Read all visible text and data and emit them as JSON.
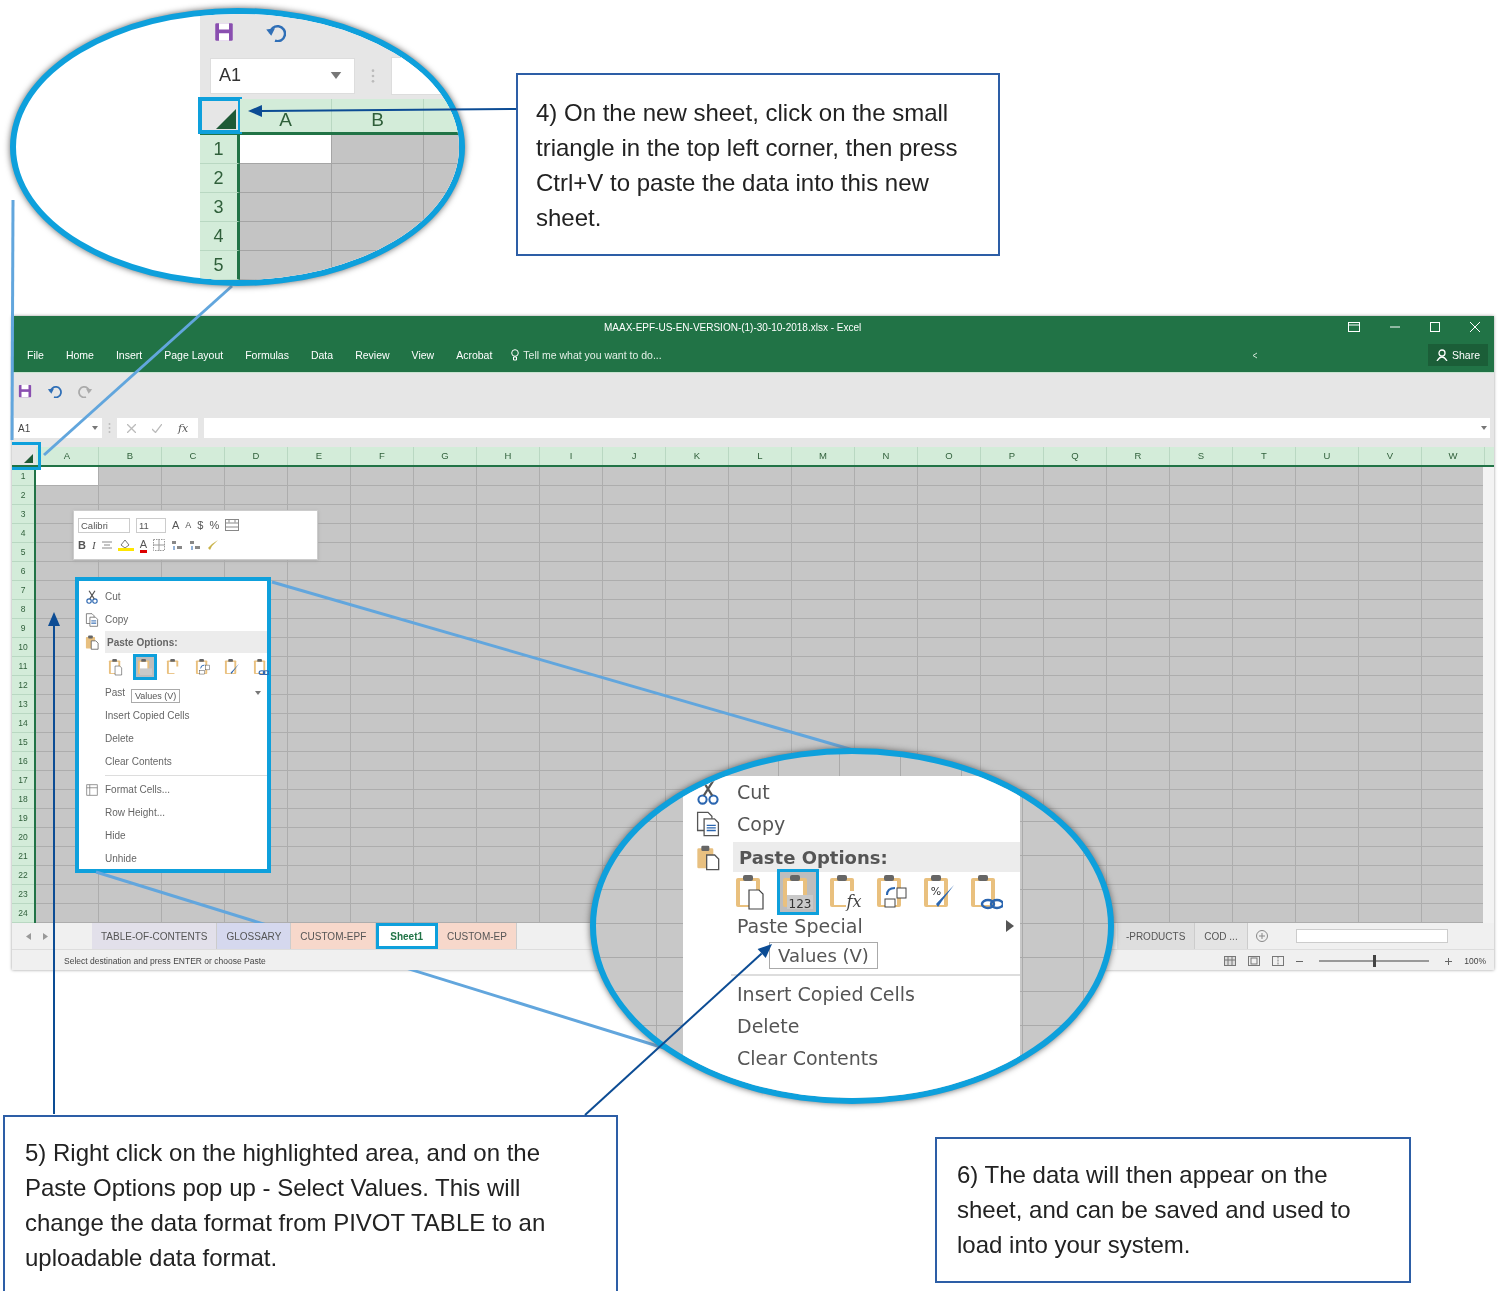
{
  "magnifier_top": {
    "name_box": "A1",
    "columns": [
      "A",
      "B"
    ],
    "rows": [
      "1",
      "2",
      "3",
      "4",
      "5"
    ]
  },
  "excel": {
    "title": "MAAX-EPF-US-EN-VERSION-(1)-30-10-2018.xlsx - Excel",
    "ribbon_tabs": [
      "File",
      "Home",
      "Insert",
      "Page Layout",
      "Formulas",
      "Data",
      "Review",
      "View",
      "Acrobat"
    ],
    "tell_me": "Tell me what you want to do...",
    "share": "Share",
    "name_box": "A1",
    "fx": "fx",
    "columns": [
      "A",
      "B",
      "C",
      "D",
      "E",
      "F",
      "G",
      "H",
      "I",
      "J",
      "K",
      "L",
      "M",
      "N",
      "O",
      "P",
      "Q",
      "R",
      "S",
      "T",
      "U",
      "V",
      "W"
    ],
    "rows": [
      "1",
      "2",
      "3",
      "4",
      "5",
      "6",
      "7",
      "8",
      "9",
      "10",
      "11",
      "12",
      "13",
      "14",
      "15",
      "16",
      "17",
      "18",
      "19",
      "20",
      "21",
      "22",
      "23",
      "24"
    ],
    "sheet_tabs": [
      {
        "label": "TABLE-OF-CONTENTS",
        "selected": false,
        "color": "#e2e0ea"
      },
      {
        "label": "GLOSSARY",
        "selected": false,
        "color": "#d5d8ee"
      },
      {
        "label": "CUSTOM-EPF",
        "selected": false,
        "color": "#f7d8cb"
      },
      {
        "label": "Sheet1",
        "selected": true,
        "color": "#ffffff"
      },
      {
        "label": "CUSTOM-EP",
        "selected": false,
        "color": "#f7d8cb"
      },
      {
        "label": "-PRODUCTS",
        "selected": false,
        "color": "#dedede"
      },
      {
        "label": "COD ...",
        "selected": false,
        "color": "#e4e4e4"
      }
    ],
    "status": "Select destination and press ENTER or choose Paste",
    "zoom": "100%",
    "zoom_slider": {
      "level": 0.5
    }
  },
  "mini_toolbar": {
    "top_group": [
      {
        "kind": "font",
        "label": "Calibri"
      },
      {
        "kind": "size",
        "label": "11"
      },
      {
        "kind": "grow",
        "label": "A"
      },
      {
        "kind": "shrink",
        "label": "A"
      },
      {
        "kind": "currency",
        "label": "$"
      },
      {
        "kind": "percent",
        "label": "%"
      },
      {
        "kind": "merge"
      }
    ],
    "bottom_group": [
      {
        "kind": "bold",
        "label": "B"
      },
      {
        "kind": "italic",
        "label": "I"
      },
      {
        "kind": "align"
      },
      {
        "kind": "fill"
      },
      {
        "kind": "font_color",
        "label": "A"
      },
      {
        "kind": "borders"
      },
      {
        "kind": "decimals"
      },
      {
        "kind": "decimals"
      },
      {
        "kind": "painter"
      }
    ]
  },
  "context_menu": {
    "tooltip": "Values (V)",
    "items": [
      {
        "kind": "cut",
        "label": "Cut"
      },
      {
        "kind": "copy",
        "label": "Copy"
      },
      {
        "kind": "header",
        "label": "Paste Options:"
      },
      {
        "kind": "paste_options",
        "options": [
          {
            "kind": "paste",
            "selected": false
          },
          {
            "kind": "values",
            "selected": true
          },
          {
            "kind": "formulas",
            "selected": false
          },
          {
            "kind": "transpose",
            "selected": false
          },
          {
            "kind": "formatting",
            "selected": false
          },
          {
            "kind": "link",
            "selected": false
          }
        ]
      },
      {
        "kind": "submenu",
        "label": "Past"
      },
      {
        "kind": "command",
        "label": "Insert Copied Cells"
      },
      {
        "kind": "command",
        "label": "Delete"
      },
      {
        "kind": "command",
        "label": "Clear Contents"
      },
      {
        "kind": "separator"
      },
      {
        "kind": "format",
        "label": "Format Cells..."
      },
      {
        "kind": "command",
        "label": "Row Height..."
      },
      {
        "kind": "command",
        "label": "Hide"
      },
      {
        "kind": "command",
        "label": "Unhide"
      }
    ]
  },
  "magnifier_menu": {
    "tooltip": "Values (V)",
    "items": [
      {
        "kind": "cut",
        "label": "Cut"
      },
      {
        "kind": "copy",
        "label": "Copy"
      },
      {
        "kind": "header",
        "label": "Paste Options:"
      },
      {
        "kind": "paste_options",
        "options": [
          {
            "kind": "paste",
            "selected": false
          },
          {
            "kind": "values",
            "selected": true,
            "label": "123"
          },
          {
            "kind": "formulas",
            "selected": false,
            "label": "fx"
          },
          {
            "kind": "transpose",
            "selected": false
          },
          {
            "kind": "formatting",
            "selected": false,
            "label": "%"
          },
          {
            "kind": "link",
            "selected": false
          }
        ]
      },
      {
        "kind": "submenu",
        "label": "Paste Special"
      },
      {
        "kind": "separator"
      },
      {
        "kind": "command",
        "label": "Insert Copied Cells"
      },
      {
        "kind": "command",
        "label": "Delete"
      },
      {
        "kind": "command",
        "label": "Clear Contents"
      }
    ]
  },
  "callouts": [
    {
      "text": "4) On the new sheet, click on the small triangle in the top left corner, then press Ctrl+V to paste the data into this new sheet."
    },
    {
      "text": "5) Right click on the highlighted area, and on the Paste Options pop up - Select Values. This will change the data format from PIVOT TABLE to an uploadable data format."
    },
    {
      "text": "6) The data will then appear on the sheet, and can be saved and used to load into your system."
    }
  ]
}
